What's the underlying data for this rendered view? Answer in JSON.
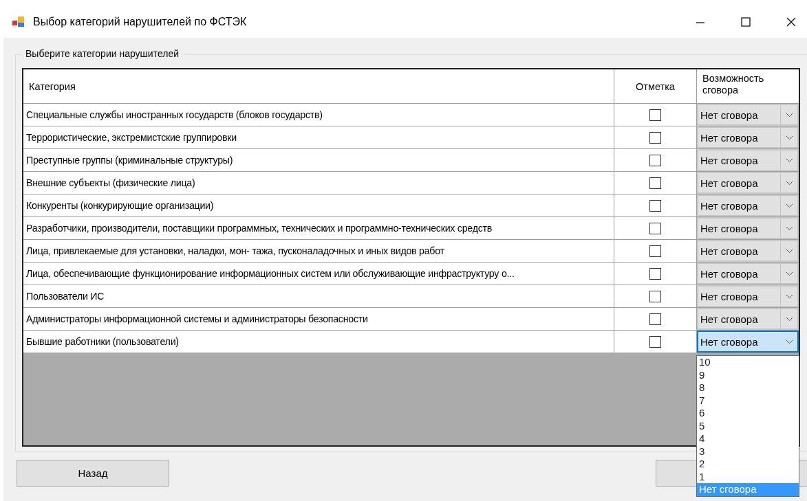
{
  "window": {
    "title": "Выбор категорий нарушителей по ФСТЭК"
  },
  "group": {
    "label": "Выберите категории нарушителей"
  },
  "table": {
    "columns": [
      "Категория",
      "Отметка",
      "Возможность сговора"
    ],
    "rows": [
      {
        "category": "Специальные службы иностранных государств (блоков государств)",
        "checked": false,
        "collusion": "Нет сговора",
        "open": false
      },
      {
        "category": "Террористические, экстремистские группировки",
        "checked": false,
        "collusion": "Нет сговора",
        "open": false
      },
      {
        "category": "Преступные группы (криминальные структуры)",
        "checked": false,
        "collusion": "Нет сговора",
        "open": false
      },
      {
        "category": "Внешние субъекты (физические лица)",
        "checked": false,
        "collusion": "Нет сговора",
        "open": false
      },
      {
        "category": "Конкуренты (конкурирующие организации)",
        "checked": false,
        "collusion": "Нет сговора",
        "open": false
      },
      {
        "category": "Разработчики, производители, поставщики программных, технических и программно-технических средств",
        "checked": false,
        "collusion": "Нет сговора",
        "open": false
      },
      {
        "category": "Лица, привлекаемые для установки, наладки, мон- тажа, пусконаладочных и иных видов работ",
        "checked": false,
        "collusion": "Нет сговора",
        "open": false
      },
      {
        "category": "Лица, обеспечивающие функционирование информационных систем или обслуживающие инфраструктуру о...",
        "checked": false,
        "collusion": "Нет сговора",
        "open": false
      },
      {
        "category": "Пользователи ИС",
        "checked": false,
        "collusion": "Нет сговора",
        "open": false
      },
      {
        "category": "Администраторы информационной системы и администраторы безопасности",
        "checked": false,
        "collusion": "Нет сговора",
        "open": false
      },
      {
        "category": "Бывшие работники (пользователи)",
        "checked": false,
        "collusion": "Нет сговора",
        "open": true
      }
    ]
  },
  "dropdown": {
    "options": [
      {
        "label": "10",
        "selected": false
      },
      {
        "label": "9",
        "selected": false
      },
      {
        "label": "8",
        "selected": false
      },
      {
        "label": "7",
        "selected": false
      },
      {
        "label": "6",
        "selected": false
      },
      {
        "label": "5",
        "selected": false
      },
      {
        "label": "4",
        "selected": false
      },
      {
        "label": "3",
        "selected": false
      },
      {
        "label": "2",
        "selected": false
      },
      {
        "label": "1",
        "selected": false
      },
      {
        "label": "Нет сговора",
        "selected": true
      }
    ]
  },
  "buttons": [
    {
      "label": "Назад"
    }
  ]
}
